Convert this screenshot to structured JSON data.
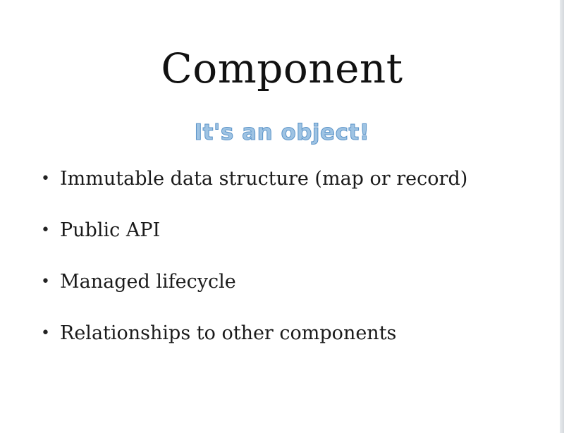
{
  "slide": {
    "title": "Component",
    "subtitle": "It's an object!",
    "bullets": [
      "Immutable data structure (map or record)",
      "Public API",
      "Managed lifecycle",
      "Relationships to other components"
    ],
    "bullet_symbol": "•"
  },
  "colors": {
    "title": "#111111",
    "subtitle_fill": "#9ec3e3",
    "subtitle_outline": "#5a93c8",
    "text": "#1a1a1a",
    "background": "#ffffff"
  }
}
